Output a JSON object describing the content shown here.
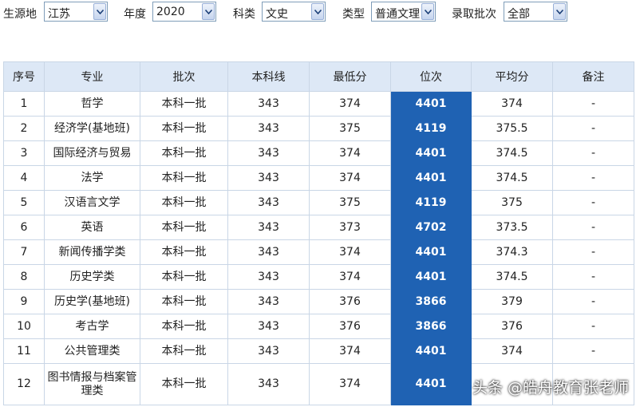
{
  "filters": {
    "source_label": "生源地",
    "source_value": "江苏",
    "year_label": "年度",
    "year_value": "2020",
    "subject_label": "科类",
    "subject_value": "文史",
    "type_label": "类型",
    "type_value": "普通文理",
    "batch_label": "录取批次",
    "batch_value": "全部"
  },
  "table": {
    "headers": [
      "序号",
      "专业",
      "批次",
      "本科线",
      "最低分",
      "位次",
      "平均分",
      "备注"
    ],
    "rows": [
      [
        "1",
        "哲学",
        "本科一批",
        "343",
        "374",
        "4401",
        "374",
        "-"
      ],
      [
        "2",
        "经济学(基地班)",
        "本科一批",
        "343",
        "375",
        "4119",
        "375.5",
        "-"
      ],
      [
        "3",
        "国际经济与贸易",
        "本科一批",
        "343",
        "374",
        "4401",
        "374.5",
        "-"
      ],
      [
        "4",
        "法学",
        "本科一批",
        "343",
        "374",
        "4401",
        "374.5",
        "-"
      ],
      [
        "5",
        "汉语言文学",
        "本科一批",
        "343",
        "375",
        "4119",
        "375",
        "-"
      ],
      [
        "6",
        "英语",
        "本科一批",
        "343",
        "373",
        "4702",
        "373.5",
        "-"
      ],
      [
        "7",
        "新闻传播学类",
        "本科一批",
        "343",
        "374",
        "4401",
        "374.3",
        "-"
      ],
      [
        "8",
        "历史学类",
        "本科一批",
        "343",
        "374",
        "4401",
        "374.5",
        "-"
      ],
      [
        "9",
        "历史学(基地班)",
        "本科一批",
        "343",
        "376",
        "3866",
        "379",
        "-"
      ],
      [
        "10",
        "考古学",
        "本科一批",
        "343",
        "376",
        "3866",
        "376",
        "-"
      ],
      [
        "11",
        "公共管理类",
        "本科一批",
        "343",
        "374",
        "4401",
        "374",
        "-"
      ],
      [
        "12",
        "图书情报与档案管理类",
        "本科一批",
        "343",
        "374",
        "4401",
        "",
        ""
      ]
    ]
  },
  "watermark": "头条 @皓舟教育张老师",
  "colors": {
    "header_bg": "#dde8f6",
    "rank_highlight": "#1f62b3",
    "border": "#c9d6e6"
  },
  "icons": {
    "dropdown": "chevron-down-icon"
  }
}
